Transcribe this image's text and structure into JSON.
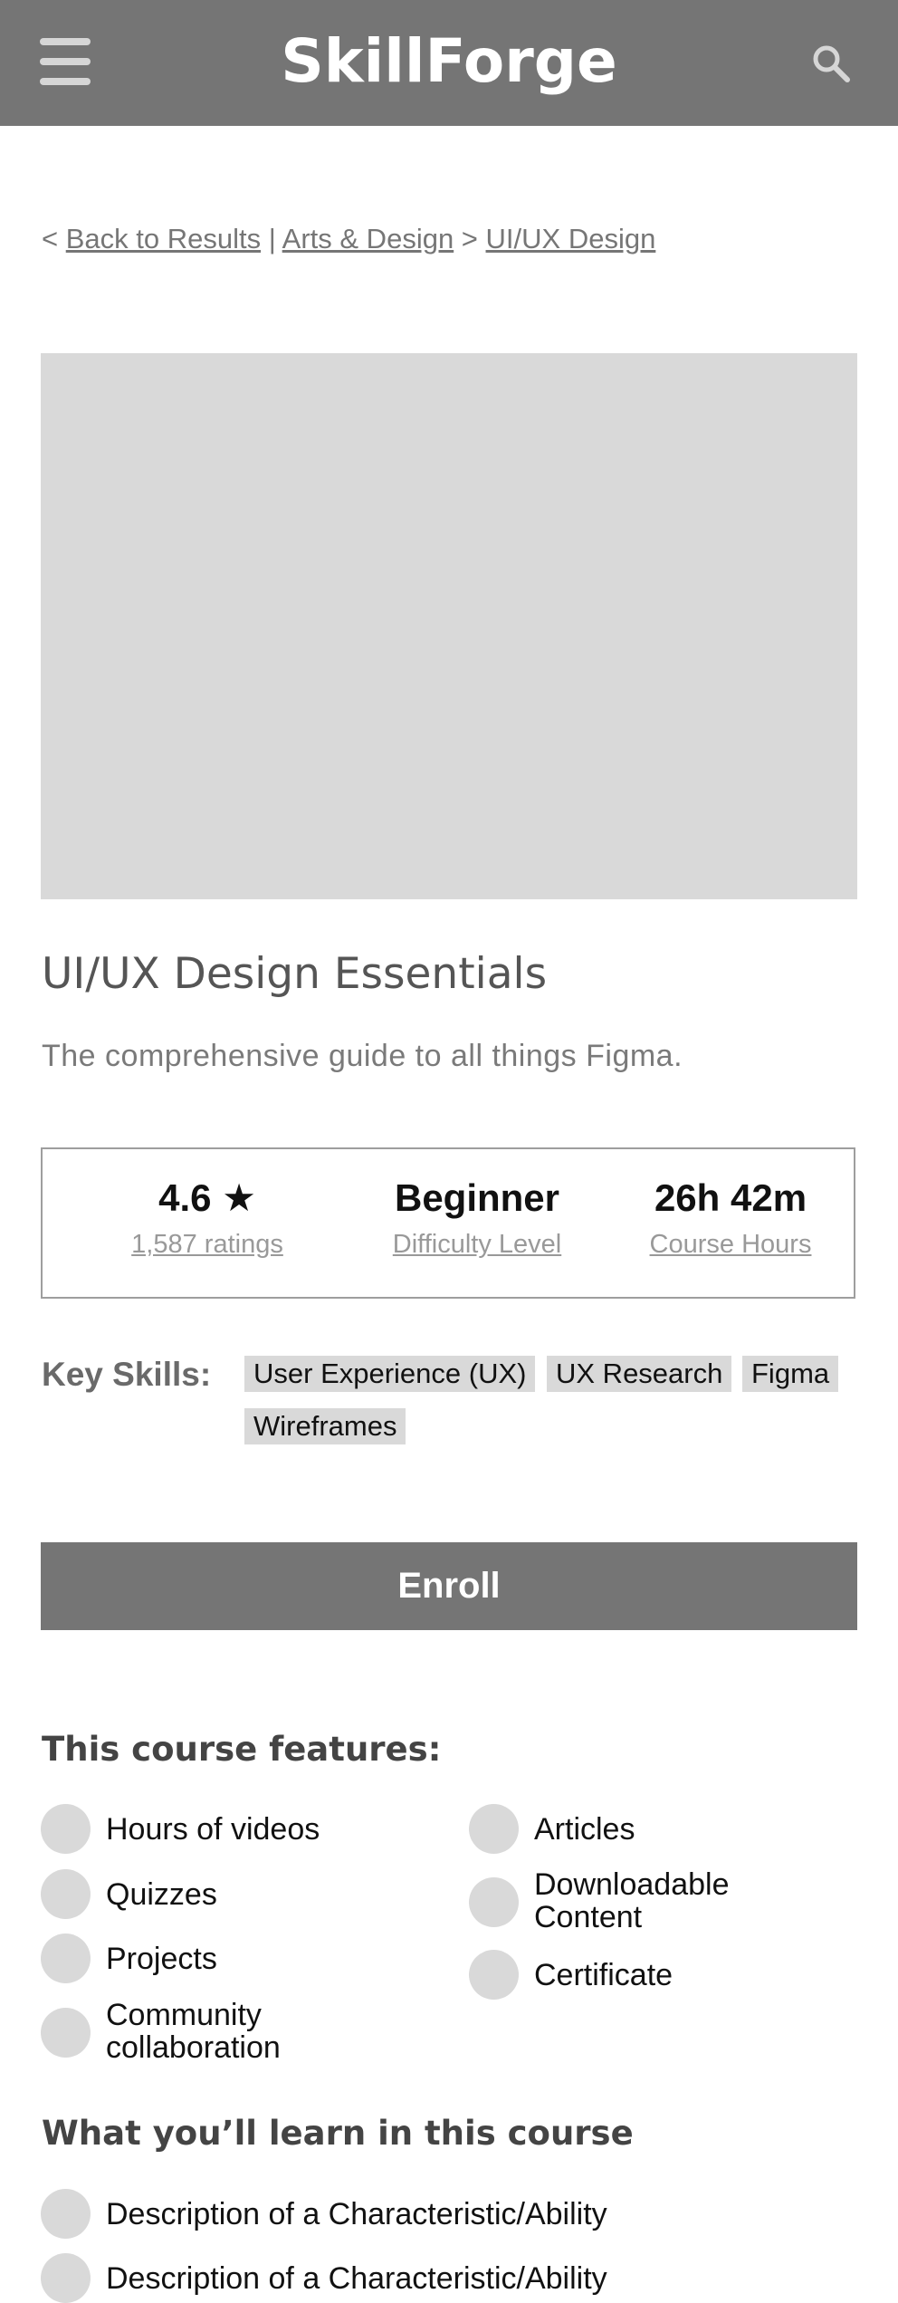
{
  "header": {
    "brand": "SkillForge",
    "menu_icon": "hamburger-icon",
    "search_icon": "search-icon"
  },
  "breadcrumb": {
    "prefix": "< ",
    "back": "Back to Results",
    "sep1": " | ",
    "category": "Arts & Design",
    "sep2": " > ",
    "subcategory": "UI/UX Design"
  },
  "course": {
    "title": "UI/UX Design Essentials",
    "subtitle": "The comprehensive guide to all things Figma."
  },
  "stats": {
    "rating_value": "4.6 ★",
    "rating_label": "1,587 ratings",
    "difficulty_value": "Beginner",
    "difficulty_label": "Difficulty Level",
    "hours_value": "26h 42m",
    "hours_label": "Course Hours"
  },
  "skills": {
    "label": "Key Skills:",
    "items": [
      "User Experience (UX)",
      "UX Research",
      "Figma",
      "Wireframes"
    ]
  },
  "enroll_label": "Enroll",
  "features": {
    "heading": "This course features:",
    "left": [
      "Hours of videos",
      "Quizzes",
      "Projects",
      "Community",
      "collaboration"
    ],
    "right": [
      "Articles",
      "Downloadable",
      "Content",
      "Certificate"
    ]
  },
  "learn": {
    "heading": "What you’ll learn in this course",
    "items": [
      "Description of a Characteristic/Ability",
      "Description of a Characteristic/Ability"
    ]
  }
}
